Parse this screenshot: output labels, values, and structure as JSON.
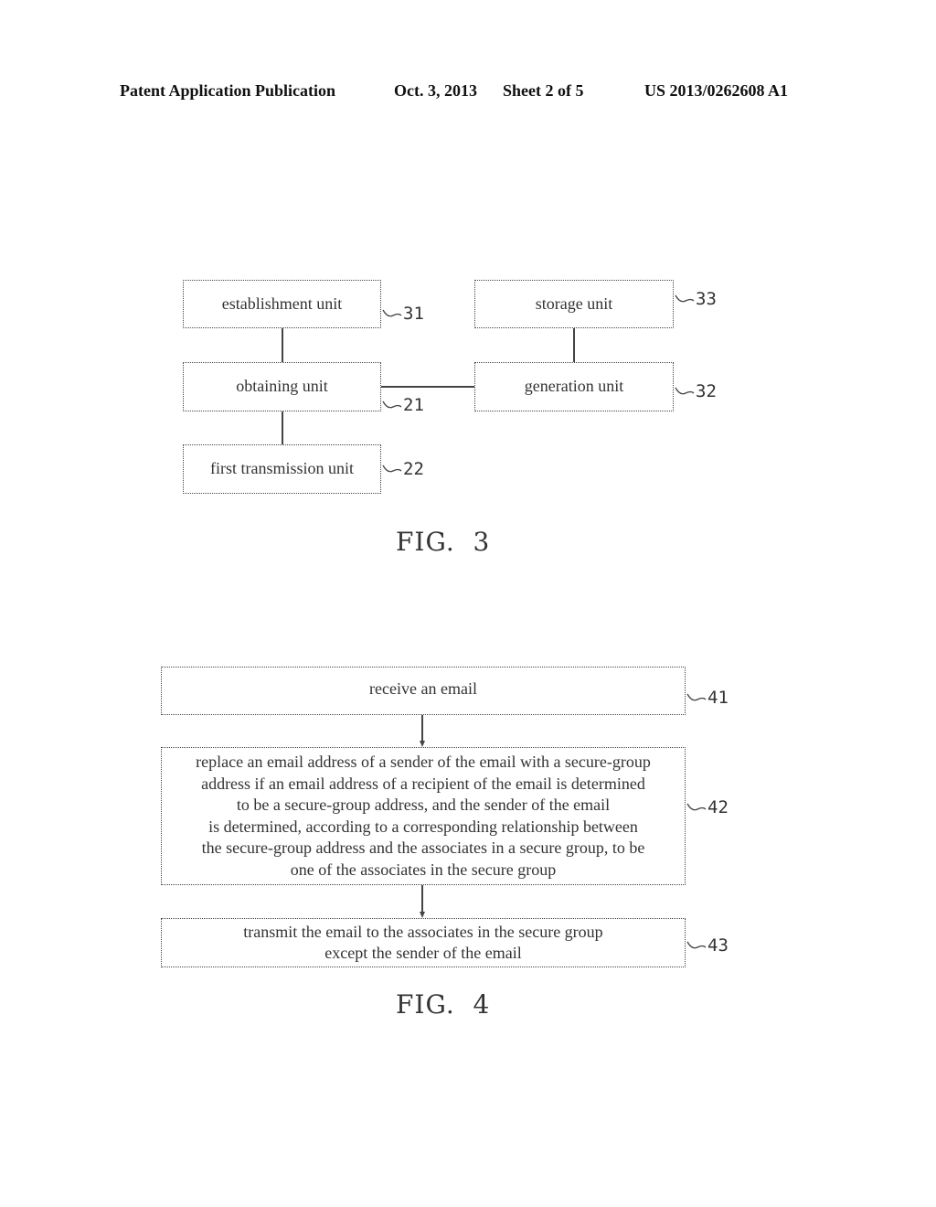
{
  "header": {
    "publication": "Patent Application Publication",
    "date": "Oct. 3, 2013",
    "sheet": "Sheet 2 of 5",
    "number": "US 2013/0262608 A1"
  },
  "fig3": {
    "caption": "FIG.  3",
    "blocks": {
      "establishment": {
        "label": "establishment unit",
        "ref": "31"
      },
      "obtaining": {
        "label": "obtaining unit",
        "ref": "21"
      },
      "first_transmission": {
        "label": "first transmission unit",
        "ref": "22"
      },
      "storage": {
        "label": "storage unit",
        "ref": "33"
      },
      "generation": {
        "label": "generation unit",
        "ref": "32"
      }
    }
  },
  "fig4": {
    "caption": "FIG.  4",
    "steps": [
      {
        "ref": "41",
        "lines": [
          "receive an email"
        ]
      },
      {
        "ref": "42",
        "lines": [
          "replace an email address of a sender of the email with a secure-group",
          "address if an email address of a recipient of the email is determined",
          "to be a secure-group address, and the sender of the email",
          "is determined, according to a corresponding relationship between",
          "the secure-group address and the associates in a secure group, to be",
          "one of the associates in the secure group"
        ]
      },
      {
        "ref": "43",
        "lines": [
          "transmit the email to the associates in the secure group",
          "except the sender of the email"
        ]
      }
    ]
  }
}
